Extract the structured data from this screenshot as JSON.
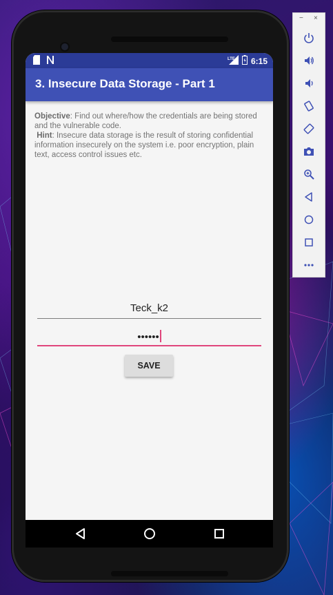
{
  "statusbar": {
    "time": "6:15",
    "icons": [
      "sd-card-icon",
      "notification-n-icon",
      "lte-signal-icon",
      "battery-icon"
    ]
  },
  "app": {
    "title": "3. Insecure Data Storage - Part 1"
  },
  "content": {
    "objective_label": "Objective",
    "objective_text": ": Find out where/how the credentials are being stored and the vulnerable code.",
    "hint_label": "Hint",
    "hint_text": ": Insecure data storage is the result of storing confidential information insecurely on the system i.e. poor encryption, plain text, access control issues etc."
  },
  "form": {
    "username_value": "Teck_k2",
    "password_value": "••••••",
    "save_label": "SAVE"
  },
  "navbar": {
    "buttons": [
      "back-icon",
      "home-icon",
      "recents-icon"
    ]
  },
  "emulator_panel": {
    "minimize": "−",
    "close": "×",
    "buttons": [
      "power-icon",
      "volume-up-icon",
      "volume-down-icon",
      "rotate-left-icon",
      "rotate-right-icon",
      "screenshot-icon",
      "zoom-icon",
      "back-icon",
      "home-icon",
      "overview-icon",
      "more-icon"
    ]
  },
  "colors": {
    "primary": "#3f51b5",
    "primary_dark": "#2b3b97",
    "accent": "#e0457b"
  }
}
